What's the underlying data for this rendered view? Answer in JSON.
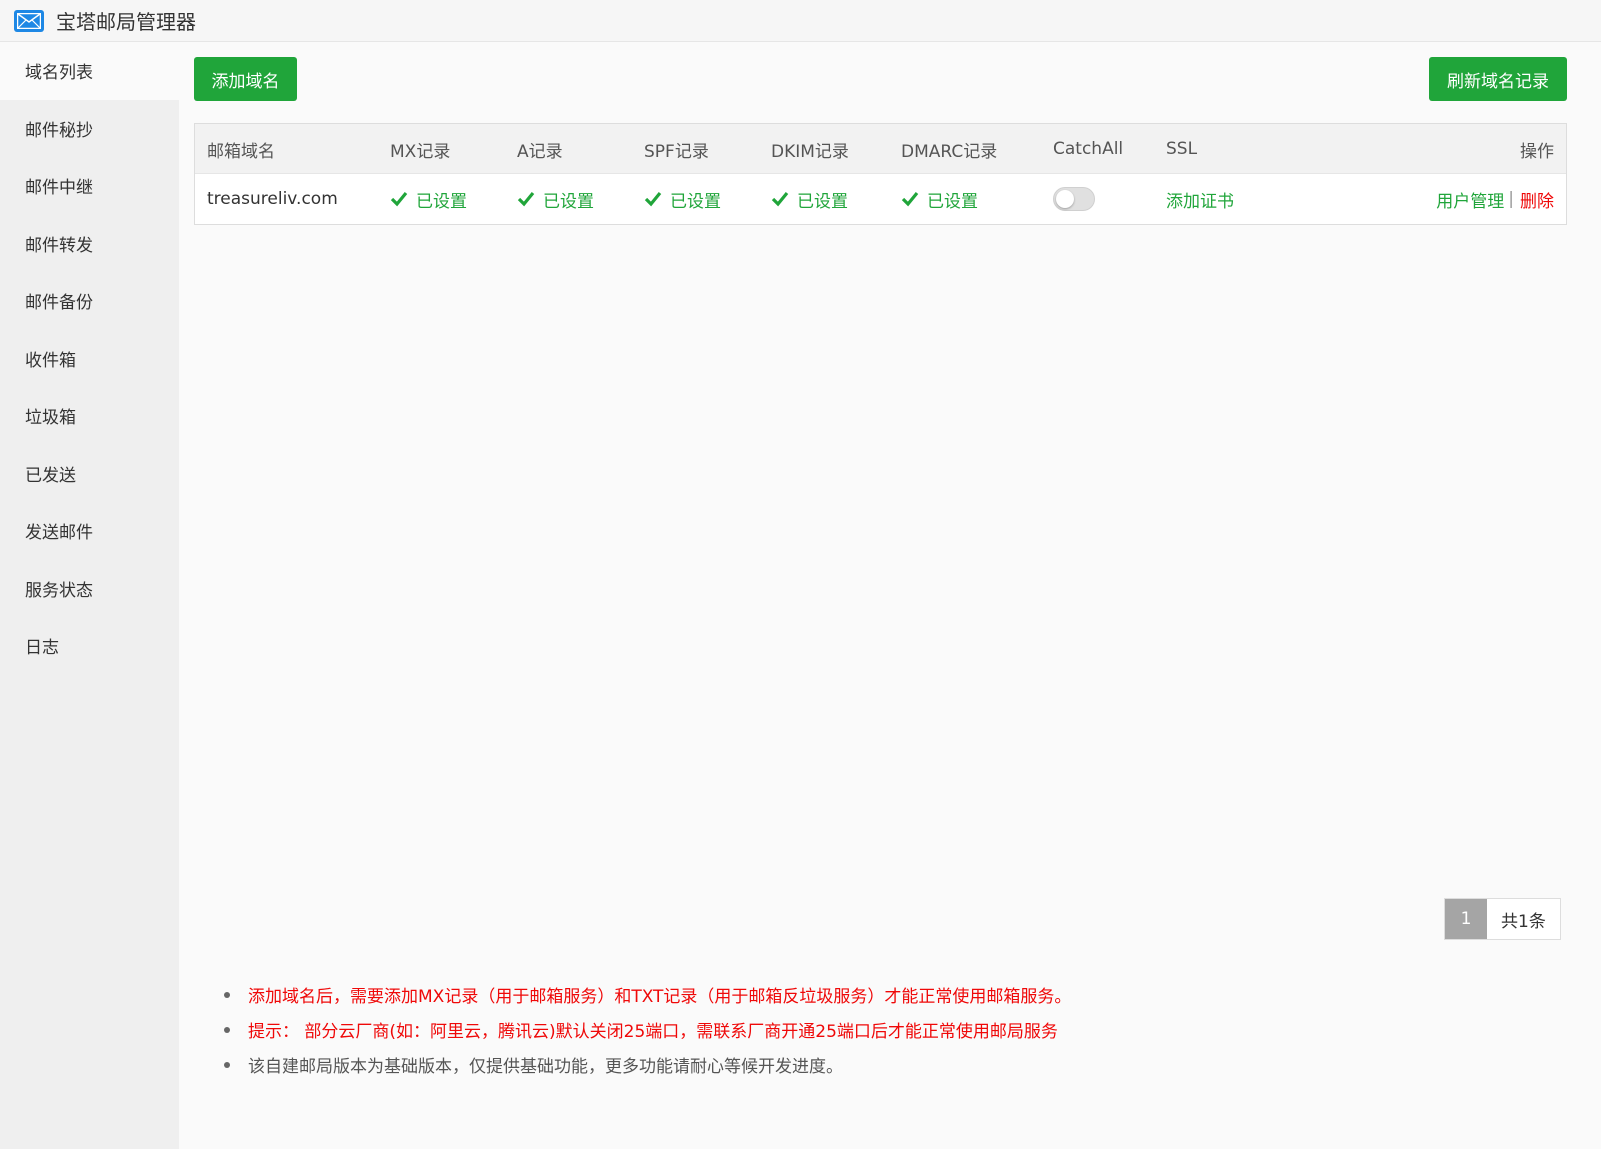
{
  "app": {
    "title": "宝塔邮局管理器",
    "icon": "envelope-icon"
  },
  "sidebar": {
    "items": [
      {
        "label": "域名列表",
        "active": true
      },
      {
        "label": "邮件秘抄",
        "active": false
      },
      {
        "label": "邮件中继",
        "active": false
      },
      {
        "label": "邮件转发",
        "active": false
      },
      {
        "label": "邮件备份",
        "active": false
      },
      {
        "label": "收件箱",
        "active": false
      },
      {
        "label": "垃圾箱",
        "active": false
      },
      {
        "label": "已发送",
        "active": false
      },
      {
        "label": "发送邮件",
        "active": false
      },
      {
        "label": "服务状态",
        "active": false
      },
      {
        "label": "日志",
        "active": false
      }
    ]
  },
  "toolbar": {
    "add_label": "添加域名",
    "refresh_label": "刷新域名记录"
  },
  "table": {
    "headers": {
      "domain": "邮箱域名",
      "mx": "MX记录",
      "a": "A记录",
      "spf": "SPF记录",
      "dkim": "DKIM记录",
      "dmarc": "DMARC记录",
      "catchall": "CatchAll",
      "ssl": "SSL",
      "ops": "操作"
    },
    "rows": [
      {
        "domain": "treasureliv.com",
        "mx": "已设置",
        "a": "已设置",
        "spf": "已设置",
        "dkim": "已设置",
        "dmarc": "已设置",
        "catchall_on": false,
        "ssl": "添加证书",
        "user_manage": "用户管理",
        "sep": "|",
        "delete": "删除"
      }
    ]
  },
  "pager": {
    "current": "1",
    "total": "共1条"
  },
  "notes": [
    "添加域名后，需要添加MX记录（用于邮箱服务）和TXT记录（用于邮箱反垃圾服务）才能正常使用邮箱服务。",
    "提示： 部分云厂商(如：阿里云，腾讯云)默认关闭25端口，需联系厂商开通25端口后才能正常使用邮局服务",
    "该自建邮局版本为基础版本，仅提供基础功能，更多功能请耐心等候开发进度。"
  ],
  "colors": {
    "accent": "#20a53a",
    "danger": "#ef0808",
    "brand_icon": "#1e88e5"
  }
}
